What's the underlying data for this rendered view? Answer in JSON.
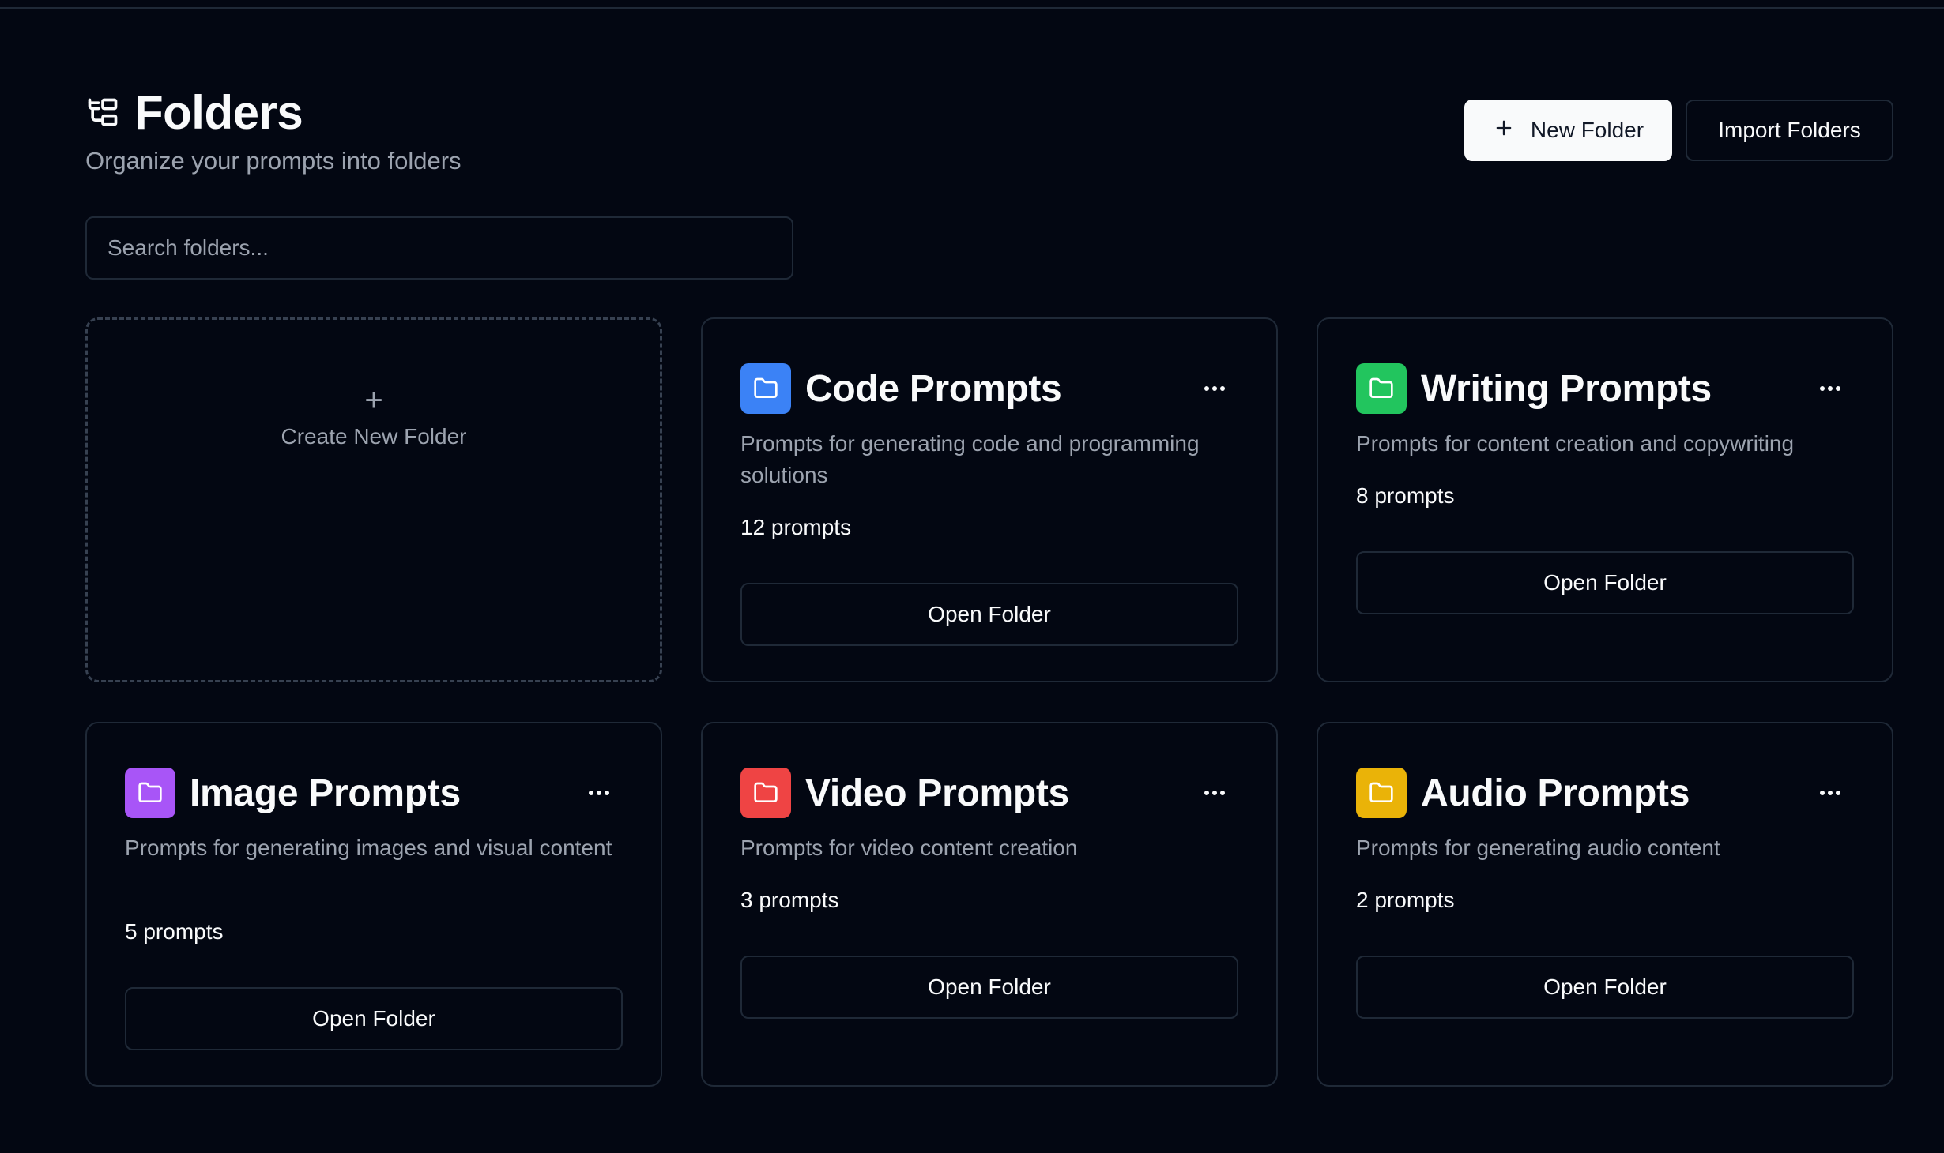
{
  "header": {
    "title": "Folders",
    "subtitle": "Organize your prompts into folders",
    "icon": "folder-tree-icon"
  },
  "actions": {
    "new_folder_label": "New Folder",
    "import_label": "Import Folders"
  },
  "search": {
    "placeholder": "Search folders...",
    "value": ""
  },
  "create_card": {
    "plus": "+",
    "label": "Create New Folder"
  },
  "folders": [
    {
      "name": "Code Prompts",
      "description": "Prompts for generating code and programming solutions",
      "count": "12 prompts",
      "color": "#3b82f6",
      "button": "Open Folder"
    },
    {
      "name": "Writing Prompts",
      "description": "Prompts for content creation and copywriting",
      "count": "8 prompts",
      "color": "#22c55e",
      "button": "Open Folder"
    },
    {
      "name": "Image Prompts",
      "description": "Prompts for generating images and visual content",
      "count": "5 prompts",
      "color": "#a855f7",
      "button": "Open Folder"
    },
    {
      "name": "Video Prompts",
      "description": "Prompts for video content creation",
      "count": "3 prompts",
      "color": "#ef4444",
      "button": "Open Folder"
    },
    {
      "name": "Audio Prompts",
      "description": "Prompts for generating audio content",
      "count": "2 prompts",
      "color": "#eab308",
      "button": "Open Folder"
    }
  ]
}
